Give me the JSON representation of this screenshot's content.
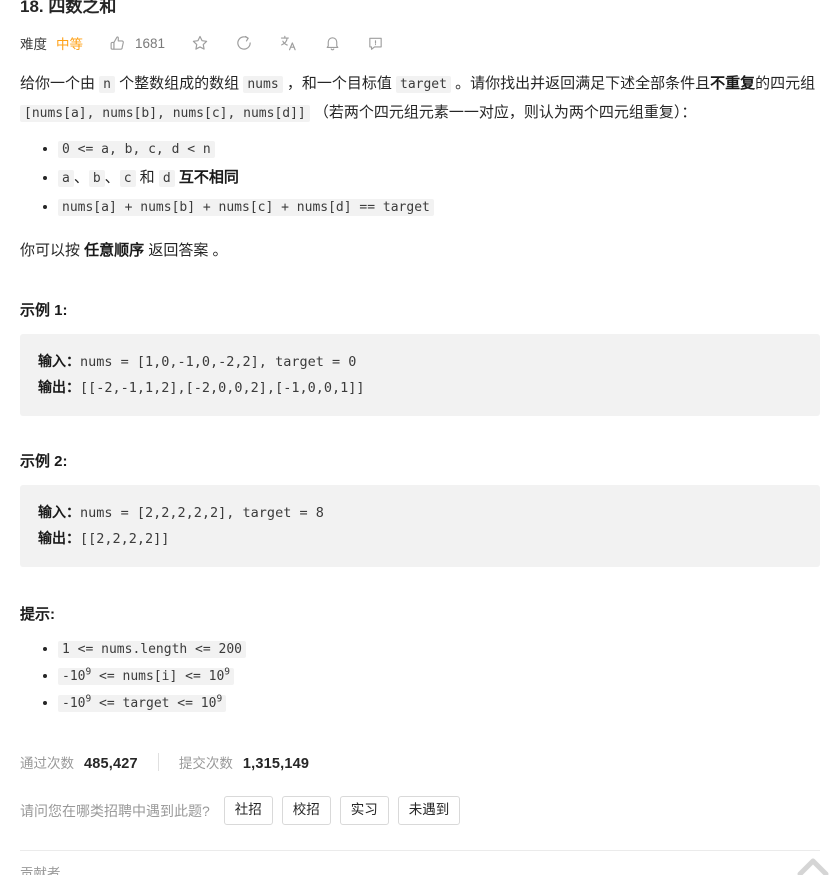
{
  "header": {
    "title": "18. 四数之和",
    "difficulty_label": "难度",
    "difficulty_value": "中等",
    "difficulty_color": "#ffa116",
    "like_count": "1681",
    "icons": [
      "thumbs-up-icon",
      "star-icon",
      "share-icon",
      "translate-icon",
      "bell-icon",
      "feedback-icon"
    ]
  },
  "description": {
    "p1_part1": "给你一个由 ",
    "p1_code1": "n",
    "p1_part2": " 个整数组成的数组 ",
    "p1_code2": "nums",
    "p1_part3": " ，和一个目标值 ",
    "p1_code3": "target",
    "p1_part4": " 。请你找出并返回满足下述全部条件且",
    "p1_bold": "不重复",
    "p1_part5": "的四元组 ",
    "p1_code4": "[nums[a], nums[b], nums[c], nums[d]]",
    "p1_part6": " （若两个四元组元素一一对应，则认为两个四元组重复）：",
    "conditions": [
      {
        "code": "0 <= a, b, c, d < n",
        "suffix": "",
        "bold": ""
      },
      {
        "code": "",
        "suffix": "",
        "bold": ""
      },
      {
        "code": "nums[a] + nums[b] + nums[c] + nums[d] == target",
        "suffix": "",
        "bold": ""
      }
    ],
    "cond2_a": "a",
    "cond2_sep1": "、",
    "cond2_b": "b",
    "cond2_sep2": "、",
    "cond2_c": "c",
    "cond2_he": " 和 ",
    "cond2_d": "d",
    "cond2_bold": " 互不相同",
    "p2_part1": "你可以按 ",
    "p2_bold": "任意顺序",
    "p2_part2": " 返回答案 。"
  },
  "examples": [
    {
      "title": "示例 1:",
      "input_label": "输入：",
      "input_value": "nums = [1,0,-1,0,-2,2], target = 0",
      "output_label": "输出：",
      "output_value": "[[-2,-1,1,2],[-2,0,0,2],[-1,0,0,1]]"
    },
    {
      "title": "示例 2:",
      "input_label": "输入：",
      "input_value": "nums = [2,2,2,2,2], target = 8",
      "output_label": "输出：",
      "output_value": "[[2,2,2,2]]"
    }
  ],
  "hints": {
    "title": "提示:",
    "items": [
      {
        "pre": "1 <= nums.length <= 200",
        "sup1": "",
        "mid": "",
        "sup2": "",
        "post": ""
      },
      {
        "pre": "-10",
        "sup1": "9",
        "mid": " <= nums[i] <= 10",
        "sup2": "9",
        "post": ""
      },
      {
        "pre": "-10",
        "sup1": "9",
        "mid": " <= target <= 10",
        "sup2": "9",
        "post": ""
      }
    ]
  },
  "stats": {
    "accepted_label": "通过次数",
    "accepted_value": "485,427",
    "submissions_label": "提交次数",
    "submissions_value": "1,315,149"
  },
  "survey": {
    "question": "请问您在哪类招聘中遇到此题?",
    "options": [
      "社招",
      "校招",
      "实习",
      "未遇到"
    ]
  },
  "footer": {
    "contributors_label": "贡献者",
    "scroll_top_icon": "chevron-up-icon"
  }
}
